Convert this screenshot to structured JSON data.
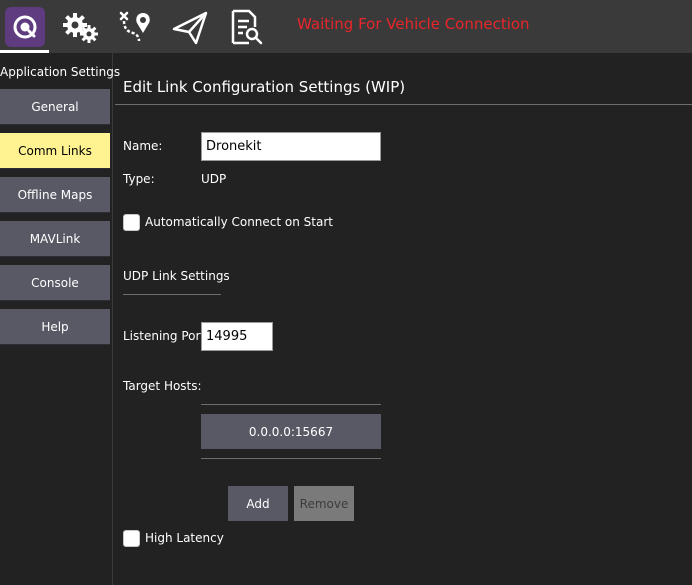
{
  "toolbar": {
    "app_icon": "qgc-logo-icon",
    "icons": [
      "gears-icon",
      "plan-route-icon",
      "paper-plane-icon",
      "document-search-icon"
    ],
    "status_text": "Waiting For Vehicle Connection",
    "status_color": "#e8262a",
    "accent": "#5f3b80"
  },
  "sidebar": {
    "title": "Application Settings",
    "items": [
      {
        "label": "General",
        "active": false
      },
      {
        "label": "Comm Links",
        "active": true
      },
      {
        "label": "Offline Maps",
        "active": false
      },
      {
        "label": "MAVLink",
        "active": false
      },
      {
        "label": "Console",
        "active": false
      },
      {
        "label": "Help",
        "active": false
      }
    ],
    "active_color": "#fff291"
  },
  "main": {
    "heading": "Edit Link Configuration Settings (WIP)",
    "name_label": "Name:",
    "name_value": "Dronekit",
    "type_label": "Type:",
    "type_value": "UDP",
    "auto_connect_label": "Automatically Connect on Start",
    "auto_connect_checked": false,
    "udp_section_title": "UDP Link Settings",
    "listening_port_label": "Listening Port",
    "listening_port_value": "14995",
    "target_hosts_label": "Target Hosts:",
    "target_hosts": [
      "0.0.0.0:15667"
    ],
    "add_label": "Add",
    "remove_label": "Remove",
    "high_latency_label": "High Latency",
    "high_latency_checked": false
  }
}
